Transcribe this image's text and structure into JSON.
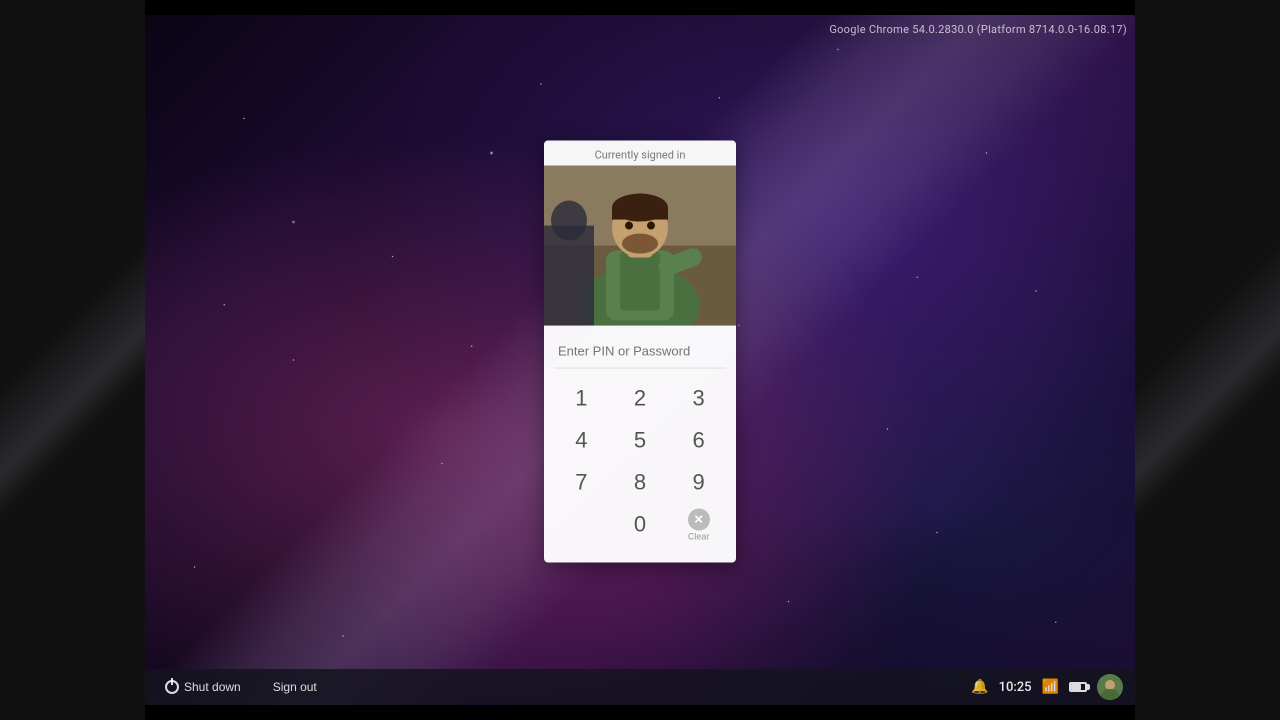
{
  "version": {
    "text": "Google Chrome 54.0.2830.0 (Platform 8714.0.0-16.08.17)"
  },
  "lock_screen": {
    "signed_in_label": "Currently signed in",
    "pin_placeholder": "Enter PIN or Password",
    "numpad": {
      "keys": [
        "1",
        "2",
        "3",
        "4",
        "5",
        "6",
        "7",
        "8",
        "9",
        "0"
      ],
      "clear_label": "Clear"
    }
  },
  "taskbar": {
    "shutdown_label": "Shut down",
    "sign_out_label": "Sign out",
    "time": "10:25"
  }
}
